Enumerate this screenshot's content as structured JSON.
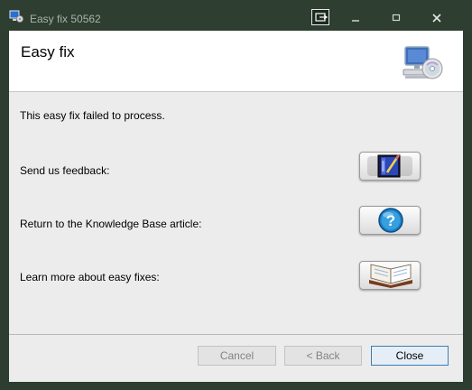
{
  "window": {
    "title": "Easy fix 50562"
  },
  "header": {
    "title": "Easy fix"
  },
  "body": {
    "message": "This easy fix failed to process.",
    "rows": [
      {
        "label": "Send us feedback:",
        "icon": "feedback-book-pencil-icon"
      },
      {
        "label": "Return to the Knowledge Base article:",
        "icon": "help-question-icon"
      },
      {
        "label": "Learn more about easy fixes:",
        "icon": "open-book-icon"
      }
    ]
  },
  "footer": {
    "cancel_label": "Cancel",
    "back_label": "< Back",
    "close_label": "Close"
  },
  "colors": {
    "accent": "#3c7fb1",
    "titlebar": "#2e3e31",
    "client": "#ececec"
  }
}
